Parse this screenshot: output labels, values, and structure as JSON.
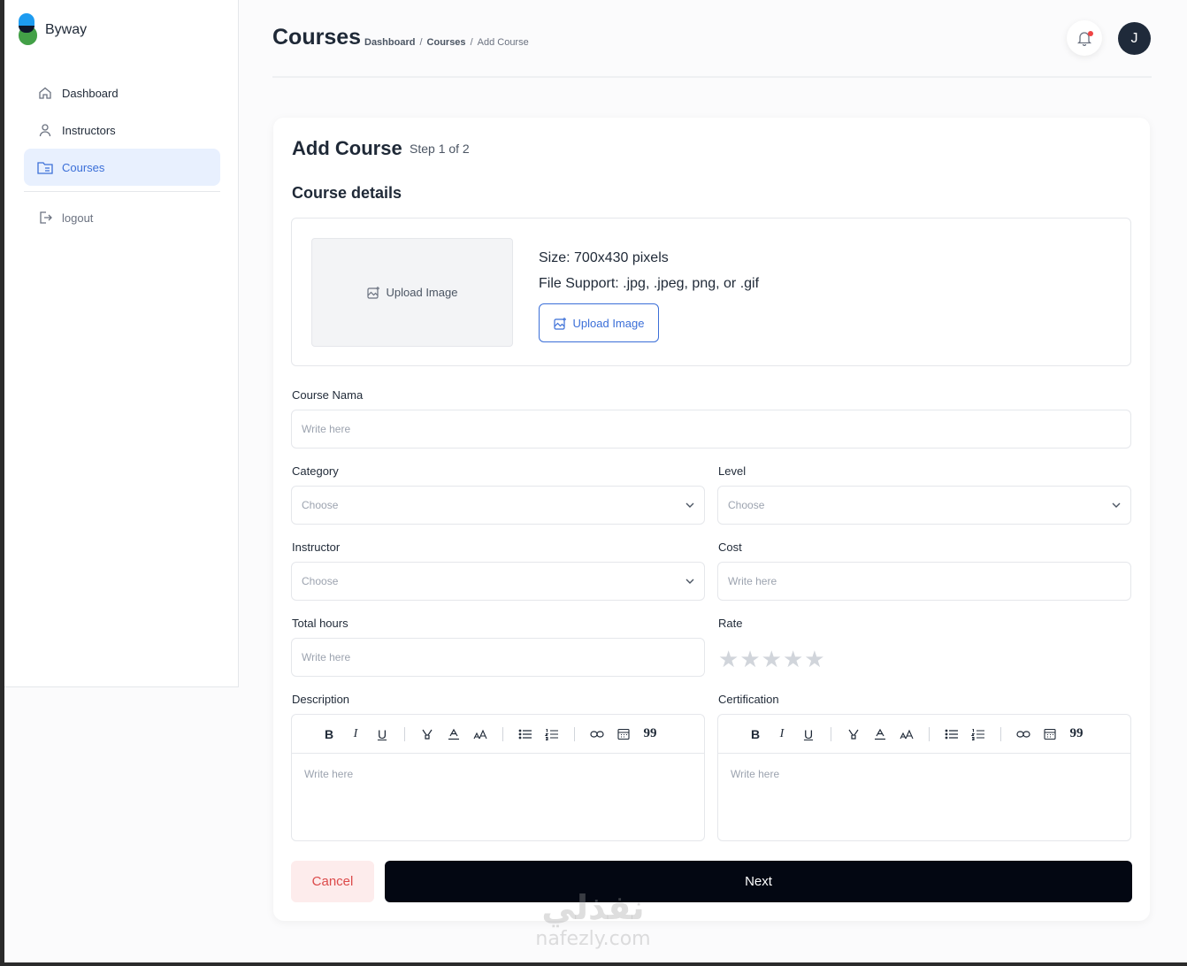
{
  "brand": {
    "name": "Byway"
  },
  "sidebar": {
    "items": [
      {
        "label": "Dashboard",
        "icon": "home-icon"
      },
      {
        "label": "Instructors",
        "icon": "user-icon"
      },
      {
        "label": "Courses",
        "icon": "folder-icon",
        "active": true
      }
    ],
    "logout": {
      "label": "logout",
      "icon": "logout-icon"
    }
  },
  "header": {
    "title": "Courses",
    "breadcrumb": [
      "Dashboard",
      "/",
      "Courses",
      "/",
      "Add Course"
    ],
    "avatar_initial": "J"
  },
  "card": {
    "title": "Add Course",
    "step": "Step 1 of 2",
    "section_title": "Course details",
    "upload": {
      "preview_label": "Upload Image",
      "size_text": "Size: 700x430 pixels",
      "support_text": "File Support: .jpg, .jpeg, png, or .gif",
      "button_label": "Upload Image"
    },
    "fields": {
      "course_name": {
        "label": "Course Nama",
        "placeholder": "Write here"
      },
      "category": {
        "label": "Category",
        "value": "Choose"
      },
      "level": {
        "label": "Level",
        "value": "Choose"
      },
      "instructor": {
        "label": "Instructor",
        "value": "Choose"
      },
      "cost": {
        "label": "Cost",
        "placeholder": "Write here"
      },
      "total_hours": {
        "label": "Total hours",
        "placeholder": "Write here"
      },
      "rate": {
        "label": "Rate",
        "stars": 5,
        "value": 0,
        "star_glyph": "★"
      },
      "description": {
        "label": "Description",
        "placeholder": "Write here"
      },
      "certification": {
        "label": "Certification",
        "placeholder": "Write here"
      }
    },
    "toolbar": {
      "bold": "B",
      "italic": "I",
      "underline": "U",
      "quote": "99"
    },
    "actions": {
      "cancel": "Cancel",
      "next": "Next"
    }
  },
  "watermark": {
    "arabic": "نفذلي",
    "latin": "nafezly.com"
  },
  "colors": {
    "accent": "#3b6fd8",
    "active_bg": "#e8f0fe",
    "cancel_bg": "#fdecec",
    "cancel_text": "#dc4a4a",
    "primary_button": "#030712",
    "notification_dot": "#ef4444"
  }
}
